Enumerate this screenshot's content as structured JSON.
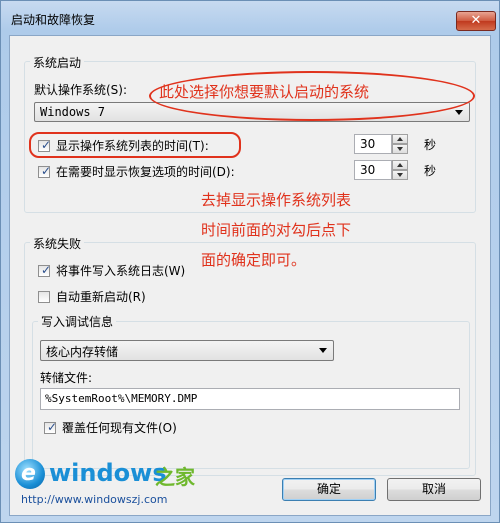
{
  "window": {
    "title": "启动和故障恢复",
    "close_glyph": "✕"
  },
  "startup": {
    "group_label": "系统启动",
    "default_os_label": "默认操作系统(S):",
    "default_os_value": "Windows 7",
    "show_list_label": "显示操作系统列表的时间(T):",
    "show_list_checked": true,
    "show_list_value": "30",
    "show_recovery_label": "在需要时显示恢复选项的时间(D):",
    "show_recovery_checked": true,
    "show_recovery_value": "30",
    "seconds_unit": "秒"
  },
  "failure": {
    "group_label": "系统失败",
    "write_log_label": "将事件写入系统日志(W)",
    "write_log_checked": true,
    "auto_restart_label": "自动重新启动(R)",
    "auto_restart_checked": false,
    "debug_group_label": "写入调试信息",
    "debug_type_value": "核心内存转储",
    "dump_file_label": "转储文件:",
    "dump_file_value": "%SystemRoot%\\MEMORY.DMP",
    "overwrite_label": "覆盖任何现有文件(O)",
    "overwrite_checked": true
  },
  "buttons": {
    "ok": "确定",
    "cancel": "取消"
  },
  "annotations": {
    "note1": "此处选择你想要默认启动的系统",
    "note2_line1": "去掉显示操作系统列表",
    "note2_line2": "时间前面的对勾后点下",
    "note2_line3": "面的确定即可。",
    "color": "#e0321c"
  },
  "watermark": {
    "logo_text": "windows",
    "logo_suffix": "之家",
    "url": "http://www.windowszj.com"
  }
}
